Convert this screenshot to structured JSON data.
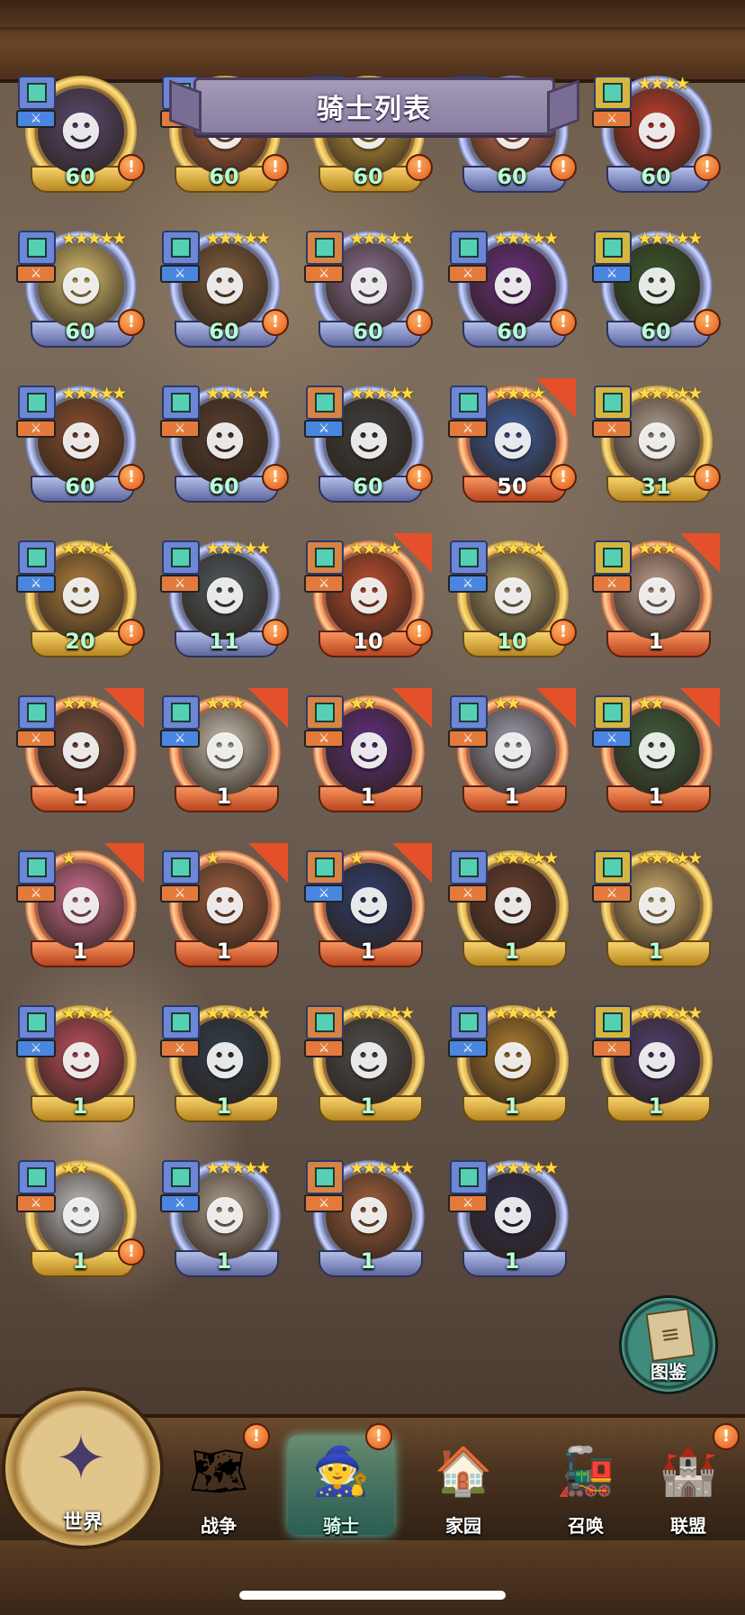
{
  "title": "骑士列表",
  "colors": {
    "gold_frame": "#e5b544",
    "blue_frame": "#8794c8",
    "red_frame": "#f28a52",
    "active_tab": "#78e6c8"
  },
  "knights": [
    {
      "level": "60",
      "frame": "gold",
      "stars": "",
      "alert": "!",
      "icon": "hooded-mage",
      "portrait_color": "#5a4a70"
    },
    {
      "level": "60",
      "frame": "gold",
      "stars": "",
      "alert": "!",
      "icon": "red-hair-girl",
      "portrait_color": "#b86a45"
    },
    {
      "level": "60",
      "frame": "gold",
      "stars": "",
      "alert": "!",
      "icon": "fox-knight",
      "portrait_color": "#c8a040"
    },
    {
      "level": "60",
      "frame": "blue",
      "stars": "★★★★",
      "alert": "!",
      "icon": "pig-boy",
      "portrait_color": "#d07050"
    },
    {
      "level": "60",
      "frame": "blue",
      "stars": "★★★★",
      "alert": "!",
      "icon": "blonde-boy",
      "portrait_color": "#c04030"
    },
    {
      "level": "60",
      "frame": "blue",
      "stars": "★★★★★",
      "alert": "!",
      "icon": "eyepatch-blonde",
      "portrait_color": "#d8c070"
    },
    {
      "level": "60",
      "frame": "blue",
      "stars": "★★★★★",
      "alert": "!",
      "icon": "glasses-man",
      "portrait_color": "#806040"
    },
    {
      "level": "60",
      "frame": "blue",
      "stars": "★★★★★",
      "alert": "!",
      "icon": "cat-knight",
      "portrait_color": "#8a7090"
    },
    {
      "level": "60",
      "frame": "blue",
      "stars": "★★★★★",
      "alert": "!",
      "icon": "masked-purple",
      "portrait_color": "#6a3080"
    },
    {
      "level": "60",
      "frame": "blue",
      "stars": "★★★★★",
      "alert": "!",
      "icon": "green-hood",
      "portrait_color": "#3c5a30"
    },
    {
      "level": "60",
      "frame": "blue",
      "stars": "★★★★★",
      "alert": "!",
      "icon": "monocle-man",
      "portrait_color": "#8a5030"
    },
    {
      "level": "60",
      "frame": "blue",
      "stars": "★★★★★",
      "alert": "!",
      "icon": "dark-warrior",
      "portrait_color": "#5a4030"
    },
    {
      "level": "60",
      "frame": "blue",
      "stars": "★★★★★",
      "alert": "!",
      "icon": "robot-gun",
      "portrait_color": "#404040"
    },
    {
      "level": "50",
      "frame": "red",
      "stars": "★★★★",
      "alert": "!",
      "icon": "goggle-boy",
      "portrait_color": "#4060a0"
    },
    {
      "level": "31",
      "frame": "gold",
      "stars": "★★★★★",
      "alert": "!",
      "icon": "white-hair",
      "portrait_color": "#b0a090"
    },
    {
      "level": "20",
      "frame": "gold",
      "stars": "★★★★",
      "alert": "!",
      "icon": "cat-girl",
      "portrait_color": "#b08040"
    },
    {
      "level": "11",
      "frame": "blue",
      "stars": "★★★★★",
      "alert": "!",
      "icon": "masked-ninja",
      "portrait_color": "#505a60"
    },
    {
      "level": "10",
      "frame": "red",
      "stars": "★★★★",
      "alert": "!",
      "icon": "redhead-woman",
      "portrait_color": "#c05030"
    },
    {
      "level": "10",
      "frame": "gold",
      "stars": "★★★★",
      "alert": "!",
      "icon": "old-scholar",
      "portrait_color": "#b0a070"
    },
    {
      "level": "1",
      "frame": "red",
      "stars": "★★★",
      "alert": "",
      "icon": "polar-bear",
      "portrait_color": "#c0a090"
    },
    {
      "level": "1",
      "frame": "red",
      "stars": "★★★",
      "alert": "",
      "icon": "brown-hair-woman",
      "portrait_color": "#7a5040"
    },
    {
      "level": "1",
      "frame": "red",
      "stars": "★★★",
      "alert": "",
      "icon": "white-cat",
      "portrait_color": "#c8c0b0"
    },
    {
      "level": "1",
      "frame": "red",
      "stars": "★★",
      "alert": "",
      "icon": "purple-wizard",
      "portrait_color": "#603080"
    },
    {
      "level": "1",
      "frame": "red",
      "stars": "★★",
      "alert": "",
      "icon": "nun",
      "portrait_color": "#a0a0b0"
    },
    {
      "level": "1",
      "frame": "red",
      "stars": "★★",
      "alert": "",
      "icon": "goggle-girl",
      "portrait_color": "#406040"
    },
    {
      "level": "1",
      "frame": "red",
      "stars": "★",
      "alert": "",
      "icon": "pink-hair-girl",
      "portrait_color": "#d07090"
    },
    {
      "level": "1",
      "frame": "red",
      "stars": "★",
      "alert": "",
      "icon": "brown-hair-girl",
      "portrait_color": "#a06040"
    },
    {
      "level": "1",
      "frame": "red",
      "stars": "★",
      "alert": "",
      "icon": "suit-man",
      "portrait_color": "#304070"
    },
    {
      "level": "1",
      "frame": "gold",
      "stars": "★★★★★",
      "alert": "",
      "icon": "aviator",
      "portrait_color": "#6a4030"
    },
    {
      "level": "1",
      "frame": "gold",
      "stars": "★★★★★",
      "alert": "",
      "icon": "round-glasses-blonde",
      "portrait_color": "#d0b070"
    },
    {
      "level": "1",
      "frame": "gold",
      "stars": "★★★★",
      "alert": "",
      "icon": "pink-hair-woman",
      "portrait_color": "#c05060"
    },
    {
      "level": "1",
      "frame": "gold",
      "stars": "★★★★★",
      "alert": "",
      "icon": "shadow-knight",
      "portrait_color": "#304050"
    },
    {
      "level": "1",
      "frame": "gold",
      "stars": "★★★★★",
      "alert": "",
      "icon": "bear-warrior",
      "portrait_color": "#505050"
    },
    {
      "level": "1",
      "frame": "gold",
      "stars": "★★★★★",
      "alert": "",
      "icon": "helmet-robot",
      "portrait_color": "#b08030"
    },
    {
      "level": "1",
      "frame": "gold",
      "stars": "★★★★★",
      "alert": "",
      "icon": "wolf-viking",
      "portrait_color": "#504070"
    },
    {
      "level": "1",
      "frame": "gold",
      "stars": "★★",
      "alert": "!",
      "icon": "white-haired-man",
      "portrait_color": "#c0c0c0"
    },
    {
      "level": "1",
      "frame": "blue",
      "stars": "★★★★★",
      "alert": "",
      "icon": "lion-beast",
      "portrait_color": "#b0a090"
    },
    {
      "level": "1",
      "frame": "blue",
      "stars": "★★★★★",
      "alert": "",
      "icon": "sunglasses-woman",
      "portrait_color": "#a06040"
    },
    {
      "level": "1",
      "frame": "blue",
      "stars": "★★★★★",
      "alert": "",
      "icon": "dark-hair-man",
      "portrait_color": "#303050"
    }
  ],
  "dex": {
    "label": "图鉴",
    "icon": "scroll-icon"
  },
  "nav": {
    "world": {
      "label": "世界",
      "icon": "compass-icon"
    },
    "items": [
      {
        "label": "战争",
        "icon": "war-map-icon",
        "alert": "!"
      },
      {
        "label": "骑士",
        "icon": "knight-icon",
        "alert": "!",
        "active": true
      },
      {
        "label": "家园",
        "icon": "house-icon",
        "alert": ""
      },
      {
        "label": "召唤",
        "icon": "train-icon",
        "alert": ""
      },
      {
        "label": "联盟",
        "icon": "alliance-icon",
        "alert": "!"
      }
    ]
  }
}
